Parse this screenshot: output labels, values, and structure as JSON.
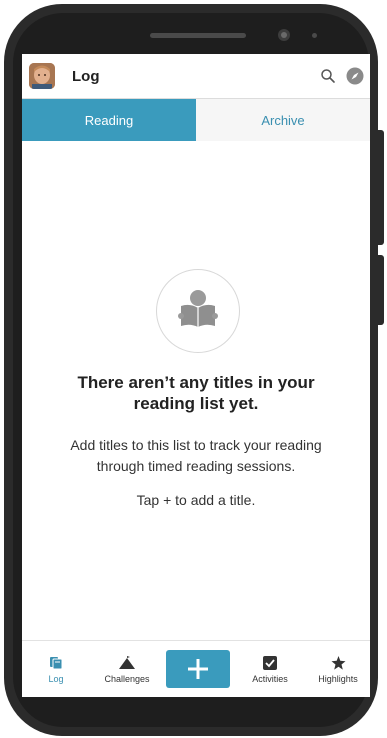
{
  "header": {
    "title": "Log"
  },
  "tabs": [
    {
      "label": "Reading",
      "active": true
    },
    {
      "label": "Archive",
      "active": false
    }
  ],
  "empty_state": {
    "title_line1": "There aren’t any titles in your",
    "title_line2": "reading list yet.",
    "body_line1": "Add titles to this list to track your reading",
    "body_line2": "through timed reading sessions.",
    "hint": "Tap + to add a title."
  },
  "bottom_nav": {
    "items": [
      {
        "label": "Log",
        "icon": "book-log-icon",
        "active": true
      },
      {
        "label": "Challenges",
        "icon": "mountain-icon",
        "active": false
      },
      {
        "label": "Activities",
        "icon": "checkbox-icon",
        "active": false
      },
      {
        "label": "Highlights",
        "icon": "star-icon",
        "active": false
      }
    ],
    "add_icon": "plus-icon"
  },
  "colors": {
    "accent": "#3a9bbd",
    "tab_inactive_text": "#3a8fb0",
    "text": "#222222"
  }
}
